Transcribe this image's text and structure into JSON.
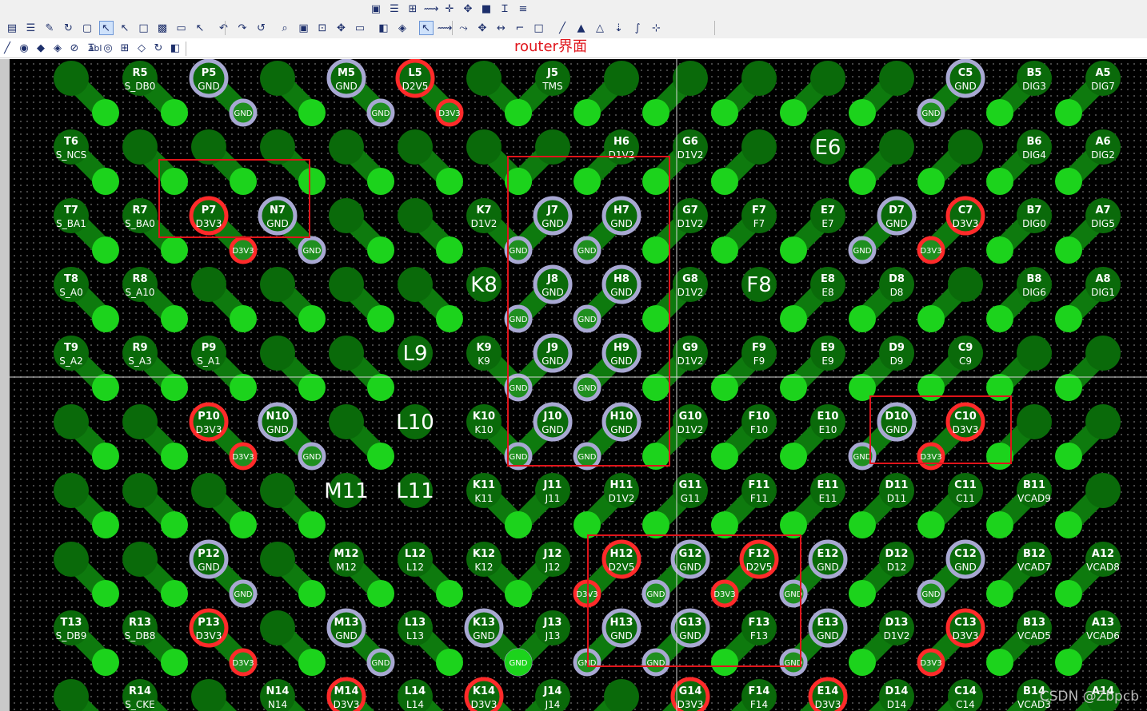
{
  "title_annotation": "router界面",
  "watermark": "CSDN @Zbpcb",
  "colors": {
    "board": "#000000",
    "track": "#0e7a0e",
    "pad": "#0a6a0a",
    "via": "#1cd31c",
    "gnd_ring": "#a8a8d2",
    "power_ring": "#ff2a2a",
    "highlight": "#e0141b"
  },
  "toolbar": {
    "top_icons": [
      "drc-icon",
      "list-icon",
      "tree-icon",
      "route-icon",
      "cross-icon",
      "move-icon",
      "chip-icon",
      "text-icon",
      "align-icon"
    ],
    "mid_icons": [
      "properties-icon",
      "list-icon",
      "tool-icon",
      "refresh-icon",
      "view-icon",
      "select-icon",
      "select-drc-icon",
      "box-icon",
      "board-icon",
      "doc-icon",
      "pointer-icon",
      "undo-icon",
      "redo-icon",
      "rotate-icon",
      "zoom-icon",
      "fit-icon",
      "zoom-window-icon",
      "pan-icon",
      "window-icon",
      "layer-icon",
      "palette-icon",
      "pointer-icon",
      "route-icon",
      "route2-icon",
      "move-icon",
      "stretch-icon",
      "corner-icon",
      "box-icon",
      "pen-icon",
      "lock-icon",
      "unlock-icon",
      "drop-icon",
      "curve-icon",
      "snap-icon"
    ],
    "bot_icons": [
      "pen-icon",
      "db-icon",
      "layers-icon",
      "palette-icon",
      "no-icon",
      "text-icon",
      "probe-icon",
      "grid-icon",
      "net-icon",
      "refresh-icon",
      "layer-icon"
    ],
    "text_tool_label": "abl"
  },
  "pcb": {
    "pads": [
      {
        "name": "R5",
        "net": "S_DB0"
      },
      {
        "name": "P5",
        "net": "GND",
        "pin": "gnd"
      },
      {
        "name": "M5",
        "net": "GND",
        "pin": "gnd"
      },
      {
        "name": "L5",
        "net": "D2V5",
        "pin": "power"
      },
      {
        "name": "J5",
        "net": "TMS"
      },
      {
        "name": "C5",
        "net": "GND",
        "pin": "gnd"
      },
      {
        "name": "B5",
        "net": "DIG3"
      },
      {
        "name": "A5",
        "net": "DIG7"
      },
      {
        "name": "T6",
        "net": "S_NCS"
      },
      {
        "name": "H6",
        "net": "D1V2"
      },
      {
        "name": "G6",
        "net": "D1V2"
      },
      {
        "name": "E6",
        "big": true
      },
      {
        "name": "B6",
        "net": "DIG4"
      },
      {
        "name": "A6",
        "net": "DIG2"
      },
      {
        "name": "T7",
        "net": "S_BA1"
      },
      {
        "name": "R7",
        "net": "S_BA0"
      },
      {
        "name": "P7",
        "net": "D3V3",
        "pin": "power"
      },
      {
        "name": "N7",
        "net": "GND",
        "pin": "gnd"
      },
      {
        "name": "K7",
        "net": "D1V2"
      },
      {
        "name": "J7",
        "net": "GND",
        "pin": "gnd"
      },
      {
        "name": "H7",
        "net": "GND",
        "pin": "gnd"
      },
      {
        "name": "G7",
        "net": "D1V2"
      },
      {
        "name": "F7",
        "net": "F7"
      },
      {
        "name": "E7",
        "net": "E7"
      },
      {
        "name": "D7",
        "net": "GND",
        "pin": "gnd"
      },
      {
        "name": "C7",
        "net": "D3V3",
        "pin": "power"
      },
      {
        "name": "B7",
        "net": "DIG0"
      },
      {
        "name": "A7",
        "net": "DIG5"
      },
      {
        "name": "T8",
        "net": "S_A0"
      },
      {
        "name": "R8",
        "net": "S_A10"
      },
      {
        "name": "K8",
        "big": true
      },
      {
        "name": "J8",
        "net": "GND",
        "pin": "gnd"
      },
      {
        "name": "H8",
        "net": "GND",
        "pin": "gnd"
      },
      {
        "name": "G8",
        "net": "D1V2"
      },
      {
        "name": "F8",
        "big": true
      },
      {
        "name": "E8",
        "net": "E8"
      },
      {
        "name": "D8",
        "net": "D8"
      },
      {
        "name": "B8",
        "net": "DIG6"
      },
      {
        "name": "A8",
        "net": "DIG1"
      },
      {
        "name": "T9",
        "net": "S_A2"
      },
      {
        "name": "R9",
        "net": "S_A3"
      },
      {
        "name": "P9",
        "net": "S_A1"
      },
      {
        "name": "L9",
        "big": true
      },
      {
        "name": "K9",
        "net": "K9"
      },
      {
        "name": "J9",
        "net": "GND",
        "pin": "gnd"
      },
      {
        "name": "H9",
        "net": "GND",
        "pin": "gnd"
      },
      {
        "name": "G9",
        "net": "D1V2"
      },
      {
        "name": "F9",
        "net": "F9"
      },
      {
        "name": "E9",
        "net": "E9"
      },
      {
        "name": "D9",
        "net": "D9"
      },
      {
        "name": "C9",
        "net": "C9"
      },
      {
        "name": "P10",
        "net": "D3V3",
        "pin": "power"
      },
      {
        "name": "N10",
        "net": "GND",
        "pin": "gnd"
      },
      {
        "name": "L10",
        "big": true
      },
      {
        "name": "K10",
        "net": "K10"
      },
      {
        "name": "J10",
        "net": "GND",
        "pin": "gnd"
      },
      {
        "name": "H10",
        "net": "GND",
        "pin": "gnd"
      },
      {
        "name": "G10",
        "net": "D1V2"
      },
      {
        "name": "F10",
        "net": "F10"
      },
      {
        "name": "E10",
        "net": "E10"
      },
      {
        "name": "D10",
        "net": "GND",
        "pin": "gnd"
      },
      {
        "name": "C10",
        "net": "D3V3",
        "pin": "power"
      },
      {
        "name": "M11",
        "big": true
      },
      {
        "name": "L11",
        "big": true
      },
      {
        "name": "K11",
        "net": "K11"
      },
      {
        "name": "J11",
        "net": "J11"
      },
      {
        "name": "H11",
        "net": "D1V2"
      },
      {
        "name": "G11",
        "net": "G11"
      },
      {
        "name": "F11",
        "net": "F11"
      },
      {
        "name": "E11",
        "net": "E11"
      },
      {
        "name": "D11",
        "net": "D11"
      },
      {
        "name": "C11",
        "net": "C11"
      },
      {
        "name": "B11",
        "net": "VCAD9"
      },
      {
        "name": "P12",
        "net": "GND",
        "pin": "gnd"
      },
      {
        "name": "M12",
        "net": "M12"
      },
      {
        "name": "L12",
        "net": "L12"
      },
      {
        "name": "K12",
        "net": "K12"
      },
      {
        "name": "J12",
        "net": "J12"
      },
      {
        "name": "H12",
        "net": "D2V5",
        "pin": "power"
      },
      {
        "name": "G12",
        "net": "GND",
        "pin": "gnd"
      },
      {
        "name": "F12",
        "net": "D2V5",
        "pin": "power"
      },
      {
        "name": "E12",
        "net": "GND",
        "pin": "gnd"
      },
      {
        "name": "D12",
        "net": "D12"
      },
      {
        "name": "C12",
        "net": "GND",
        "pin": "gnd"
      },
      {
        "name": "B12",
        "net": "VCAD7"
      },
      {
        "name": "A12",
        "net": "VCAD8"
      },
      {
        "name": "T13",
        "net": "S_DB9"
      },
      {
        "name": "R13",
        "net": "S_DB8"
      },
      {
        "name": "P13",
        "net": "D3V3",
        "pin": "power"
      },
      {
        "name": "M13",
        "net": "GND",
        "pin": "gnd"
      },
      {
        "name": "L13",
        "net": "L13"
      },
      {
        "name": "K13",
        "net": "GND",
        "pin": "gnd"
      },
      {
        "name": "J13",
        "net": "J13"
      },
      {
        "name": "H13",
        "net": "GND",
        "pin": "gnd"
      },
      {
        "name": "G13",
        "net": "GND",
        "pin": "gnd"
      },
      {
        "name": "F13",
        "net": "F13"
      },
      {
        "name": "E13",
        "net": "GND",
        "pin": "gnd"
      },
      {
        "name": "D13",
        "net": "D1V2"
      },
      {
        "name": "C13",
        "net": "D3V3",
        "pin": "power"
      },
      {
        "name": "B13",
        "net": "VCAD5"
      },
      {
        "name": "A13",
        "net": "VCAD6"
      },
      {
        "name": "R14",
        "net": "S_CKE"
      },
      {
        "name": "N14",
        "net": "N14"
      },
      {
        "name": "M14",
        "net": "D3V3",
        "pin": "power"
      },
      {
        "name": "L14",
        "net": "L14"
      },
      {
        "name": "K14",
        "net": "D3V3",
        "pin": "power"
      },
      {
        "name": "J14",
        "net": "J14"
      },
      {
        "name": "G14",
        "net": "D3V3",
        "pin": "power"
      },
      {
        "name": "F14",
        "net": "F14"
      },
      {
        "name": "E14",
        "net": "D3V3",
        "pin": "power"
      },
      {
        "name": "D14",
        "net": "D14"
      },
      {
        "name": "C14",
        "net": "C14"
      },
      {
        "name": "B14",
        "net": "VCAD3"
      },
      {
        "name": "A14"
      }
    ],
    "via_labels": [
      "D1V2",
      "D1V2",
      "D1V2",
      "D1V2",
      "D1V2",
      "D1V2",
      "D1V2",
      "D1V2",
      "D1V2",
      "D1V2",
      "D1V2",
      "D1V2",
      "DIG4",
      "DIG2",
      "S_BA1",
      "S_BA0",
      "D3V3",
      "GND",
      "S_A0",
      "S_A10",
      "DIG1",
      "S_A2",
      "S_A3",
      "S_A1",
      "K9",
      "E9",
      "F9",
      "D9",
      "C9",
      "D3V3",
      "GND",
      "K10",
      "F10",
      "E10",
      "GND",
      "D3V3",
      "K11",
      "J11",
      "G11",
      "F11",
      "E11",
      "D11",
      "C11",
      "GND",
      "M12",
      "L12",
      "K12",
      "J12",
      "D2V5",
      "GND",
      "D2V5",
      "GND",
      "D12",
      "GND",
      "D3V3",
      "GND",
      "L13",
      "GND",
      "J13",
      "GND",
      "GND",
      "F13",
      "GND",
      "D3V3",
      "D3V3",
      "GND",
      "GND",
      "GND",
      "GND",
      "GND",
      "GND",
      "GND",
      "GND"
    ],
    "big_labels": [
      "E6",
      "F7",
      "E7",
      "E8",
      "D8",
      "K8",
      "F8",
      "L9",
      "K9",
      "F9",
      "E9",
      "D9",
      "C9",
      "L10",
      "K10",
      "F10",
      "E10",
      "M11",
      "L11",
      "K11",
      "J11",
      "G11",
      "F11",
      "E11",
      "D11",
      "C11",
      "M12",
      "L12",
      "K12",
      "J12",
      "D12",
      "L13",
      "J13",
      "F13"
    ],
    "highlight_boxes": [
      "highlight-box-p7-n7",
      "highlight-box-j-h-column",
      "highlight-box-d10-c10",
      "highlight-box-h12-f13"
    ]
  }
}
